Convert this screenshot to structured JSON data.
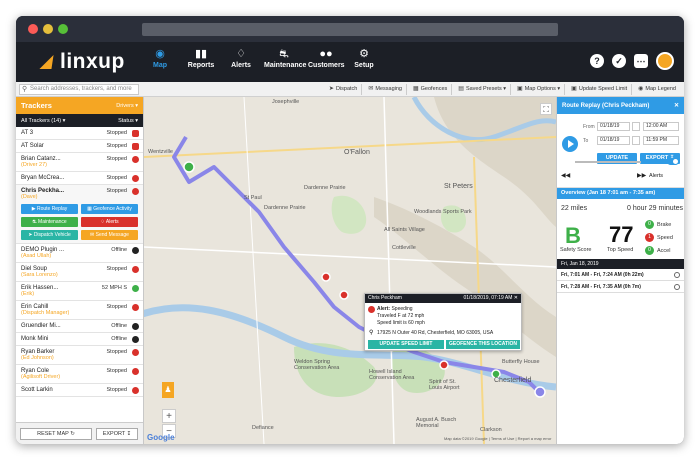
{
  "window": {
    "controls": [
      "close",
      "minimize",
      "maximize"
    ]
  },
  "nav": {
    "logo": "linxup",
    "items": [
      {
        "label": "Map",
        "icon": "car-icon",
        "active": true
      },
      {
        "label": "Reports",
        "icon": "bar-chart-icon",
        "active": false
      },
      {
        "label": "Alerts",
        "icon": "bell-icon",
        "active": false
      },
      {
        "label": "Maintenance",
        "icon": "truck-icon",
        "active": false
      },
      {
        "label": "Customers",
        "icon": "users-icon",
        "active": false
      },
      {
        "label": "Setup",
        "icon": "gear-icon",
        "active": false
      }
    ],
    "right_icons": [
      "help-icon",
      "check-icon",
      "chat-icon",
      "user-avatar"
    ]
  },
  "toolbar": {
    "search_placeholder": "Search addresses, trackers, and more",
    "items": [
      {
        "label": "Dispatch",
        "icon": "dispatch-icon"
      },
      {
        "label": "Messaging",
        "icon": "message-icon"
      },
      {
        "label": "Geofences",
        "icon": "geofence-icon"
      },
      {
        "label": "Saved Presets",
        "icon": "presets-icon"
      },
      {
        "label": "Map Options",
        "icon": "map-options-icon"
      },
      {
        "label": "Update Speed Limit",
        "icon": "speed-icon"
      },
      {
        "label": "Map Legend",
        "icon": "legend-icon"
      }
    ]
  },
  "trackers": {
    "title": "Trackers",
    "filter_label": "Drivers",
    "sub_left": "All Trackers (14)",
    "sub_right": "Status",
    "rows": [
      {
        "name": "AT 3",
        "sub": "",
        "status": "Stopped",
        "badge": "red"
      },
      {
        "name": "AT Solar",
        "sub": "",
        "status": "Stopped",
        "badge": "red"
      },
      {
        "name": "Brian Catanz...",
        "sub": "(Driver 27)",
        "status": "Stopped",
        "badge": "red-circle"
      },
      {
        "name": "Bryan McCrea...",
        "sub": "",
        "status": "Stopped",
        "badge": "red-circle"
      },
      {
        "name": "Chris Peckha...",
        "sub": "(Dave)",
        "status": "Stopped",
        "badge": "red-circle",
        "expanded": true
      },
      {
        "name": "DEMO Plugin ...",
        "sub": "(Asad Ullah)",
        "status": "Offline",
        "badge": "dark"
      },
      {
        "name": "Diel Soup",
        "sub": "(Sara Lorenzo)",
        "status": "Stopped",
        "badge": "red-circle"
      },
      {
        "name": "Erik Hassen...",
        "sub": "(Erik)",
        "status": "52 MPH S",
        "badge": "green"
      },
      {
        "name": "Erin Cahill",
        "sub": "(Dispatch Manager)",
        "status": "Stopped",
        "badge": "red-circle"
      },
      {
        "name": "Gruendler Mi...",
        "sub": "",
        "status": "Offline",
        "badge": "dark"
      },
      {
        "name": "Monk Mini",
        "sub": "",
        "status": "Offline",
        "badge": "dark"
      },
      {
        "name": "Ryan Barker",
        "sub": "(Ed Johnson)",
        "status": "Stopped",
        "badge": "red-circle"
      },
      {
        "name": "Ryan Cole",
        "sub": "(Agilisoft Driver)",
        "status": "Stopped",
        "badge": "red-circle"
      },
      {
        "name": "Scott Larkin",
        "sub": "",
        "status": "Stopped",
        "badge": "red-circle"
      }
    ],
    "actions": [
      {
        "label": "Route Replay",
        "color": "#2f9be5",
        "icon": "play-icon"
      },
      {
        "label": "Geofence Activity",
        "color": "#2f9be5",
        "icon": "geofence-icon"
      },
      {
        "label": "Maintenance",
        "color": "#3eb049",
        "icon": "truck-icon"
      },
      {
        "label": "Alerts",
        "color": "#d9312b",
        "icon": "bell-icon"
      },
      {
        "label": "Dispatch Vehicle",
        "color": "#2ab5a5",
        "icon": "dispatch-icon"
      },
      {
        "label": "Send Message",
        "color": "#f5a623",
        "icon": "message-icon"
      }
    ],
    "footer": {
      "reset_label": "RESET MAP",
      "export_label": "EXPORT"
    }
  },
  "map": {
    "labels": [
      {
        "text": "Josephville"
      },
      {
        "text": "Wentzville"
      },
      {
        "text": "O'Fallon"
      },
      {
        "text": "St Peters"
      },
      {
        "text": "Dardenne Prairie"
      },
      {
        "text": "St Paul"
      },
      {
        "text": "Cottleville"
      },
      {
        "text": "All Saints Village"
      },
      {
        "text": "Woodlands Sports Park"
      },
      {
        "text": "Weldon Spring Conservation Area"
      },
      {
        "text": "Howell Island Conservation Area"
      },
      {
        "text": "Chesterfield"
      },
      {
        "text": "Butterfly House"
      },
      {
        "text": "Spirit of St. Louis Airport"
      },
      {
        "text": "Defiance"
      },
      {
        "text": "Dardenne Prairie"
      },
      {
        "text": "August A. Busch Memorial"
      },
      {
        "text": "Clarkson"
      }
    ],
    "attribution": "Map data ©2019 Google | Terms of Use | Report a map error",
    "google_logo": "Google",
    "zoom_in": "+",
    "zoom_out": "−",
    "route_color": "#8a86e8",
    "popup": {
      "title": "Chris Peckham",
      "time": "01/18/2019, 07:19 AM",
      "alert_label": "Alert:",
      "alert_value": "Speeding",
      "travel_line": "Traveled F at 72 mph",
      "limit_line": "Speed limit is 60 mph",
      "address": "17925 N Outer 40 Rd, Chesterfield, MO 63005, USA",
      "btn_update": "UPDATE SPEED LIMIT",
      "btn_geofence": "GEOFENCE THIS LOCATION"
    }
  },
  "replay": {
    "title": "Route Replay (Chris Peckham)",
    "from_label": "From",
    "to_label": "To",
    "from_date": "01/18/19",
    "from_time": "12:00 AM",
    "to_date": "01/18/19",
    "to_time": "11:59 PM",
    "update_label": "UPDATE",
    "export_label": "EXPORT",
    "alerts_label": "Alerts",
    "overview": "Overview (Jan 18 7:01 am - 7:35 am)",
    "miles": "22 miles",
    "duration": "0 hour 29 minutes",
    "grade": "B",
    "grade_label": "Safety Score",
    "top_speed": "77",
    "top_speed_label": "Top Speed",
    "categories": [
      {
        "count": "0",
        "label": "Brake",
        "color": "#3eb049"
      },
      {
        "count": "1",
        "label": "Speed",
        "color": "#d9312b"
      },
      {
        "count": "0",
        "label": "Accel",
        "color": "#3eb049"
      }
    ],
    "day": "Fri, Jan 18, 2019",
    "trips": [
      {
        "text": "Fri, 7:01 AM - Fri, 7:24 AM (0h 22m)"
      },
      {
        "text": "Fri, 7:28 AM - Fri, 7:35 AM (0h 7m)"
      }
    ]
  }
}
